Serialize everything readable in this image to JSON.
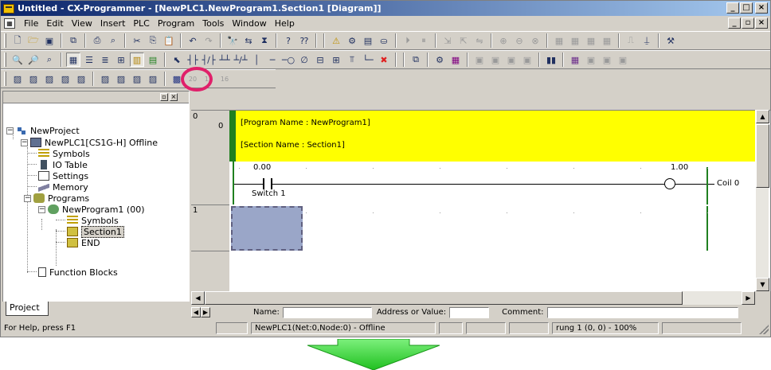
{
  "window": {
    "title": "Untitled - CX-Programmer - [NewPLC1.NewProgram1.Section1 [Diagram]]",
    "controls": [
      "_",
      "□",
      "×"
    ]
  },
  "menu": {
    "items": [
      "File",
      "Edit",
      "View",
      "Insert",
      "PLC",
      "Program",
      "Tools",
      "Window",
      "Help"
    ],
    "doc_controls": [
      "_",
      "▫",
      "×"
    ]
  },
  "toolbar3": {
    "disabled_numbers": [
      "20",
      "15",
      "16"
    ]
  },
  "project_tree": {
    "root": "NewProject",
    "plc": "NewPLC1[CS1G-H] Offline",
    "plc_children": [
      "Symbols",
      "IO Table",
      "Settings",
      "Memory",
      "Programs",
      "Function Blocks"
    ],
    "program": "NewProgram1 (00)",
    "program_children": [
      "Symbols",
      "Section1",
      "END"
    ],
    "selected": "Section1",
    "tab": "Project"
  },
  "ladder": {
    "rungs": [
      {
        "number": "0",
        "step": "0"
      },
      {
        "number": "1",
        "step": ""
      }
    ],
    "program_comment": "[Program Name : NewProgram1]",
    "section_comment": "[Section Name : Section1]",
    "contact": {
      "address": "0.00",
      "label": "Switch 1"
    },
    "coil": {
      "address": "1.00",
      "label": "Coil 0"
    }
  },
  "fields": {
    "name_label": "Name:",
    "address_label": "Address or Value:",
    "comment_label": "Comment:"
  },
  "status": {
    "help": "For Help, press F1",
    "connection": "NewPLC1(Net:0,Node:0) - Offline",
    "position": "rung 1 (0, 0)  - 100%"
  },
  "colors": {
    "accent_ring": "#e0206a",
    "comment_bg": "#ffff00",
    "rail": "#208020",
    "arrow": "#33dd33"
  }
}
